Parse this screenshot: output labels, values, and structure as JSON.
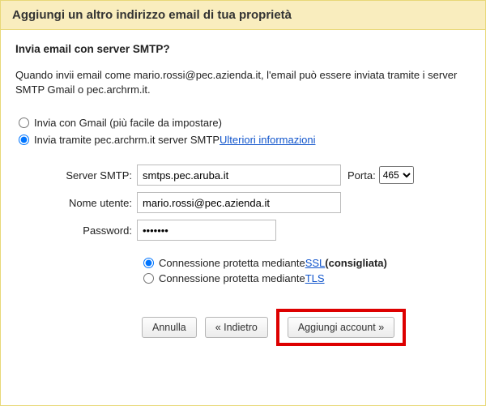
{
  "title": "Aggiungi un altro indirizzo email di tua proprietà",
  "subheader": "Invia email con server SMTP?",
  "description": "Quando invii email come mario.rossi@pec.azienda.it, l'email può essere inviata tramite i server SMTP Gmail o pec.archrm.it.",
  "option_gmail": "Invia con Gmail (più facile da impostare)",
  "option_smtp_prefix": "Invia tramite pec.archrm.it server SMTP ",
  "option_smtp_link": "Ulteriori informazioni",
  "labels": {
    "server": "Server SMTP:",
    "porta": "Porta:",
    "user": "Nome utente:",
    "password": "Password:"
  },
  "values": {
    "server": "smtps.pec.aruba.it",
    "porta": "465",
    "user": "mario.rossi@pec.azienda.it",
    "password_mask": "•••••••"
  },
  "security": {
    "ssl_text": "Connessione protetta mediante ",
    "ssl_link": "SSL",
    "ssl_suffix": " (consigliata)",
    "tls_text": "Connessione protetta mediante ",
    "tls_link": "TLS"
  },
  "buttons": {
    "cancel": "Annulla",
    "back": "« Indietro",
    "add": "Aggiungi account »"
  }
}
